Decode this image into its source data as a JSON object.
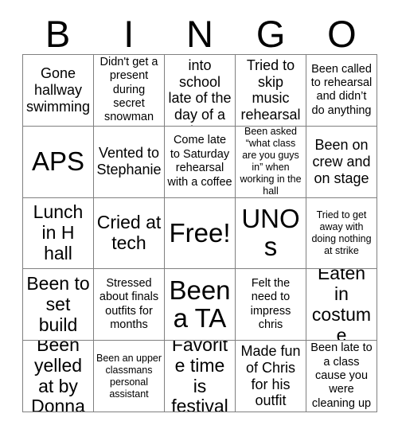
{
  "card": {
    "header_letters": [
      "B",
      "I",
      "N",
      "G",
      "O"
    ],
    "rows": [
      [
        {
          "text": "Gone hallway swimming",
          "size": "md"
        },
        {
          "text": "Didn't get a present during secret snowman",
          "size": "sm"
        },
        {
          "text": "Come into school late of the day of a show",
          "size": "md"
        },
        {
          "text": "Tried to skip music rehearsal",
          "size": "md"
        },
        {
          "text": "Been called to rehearsal and didn’t do anything",
          "size": "sm"
        }
      ],
      [
        {
          "text": "APS",
          "size": "xl"
        },
        {
          "text": "Vented to Stephanie",
          "size": "md"
        },
        {
          "text": "Come late to Saturday rehearsal with a coffee",
          "size": "sm"
        },
        {
          "text": "Been asked “what class are you guys in” when working in the hall",
          "size": "xs"
        },
        {
          "text": "Been on crew and on stage",
          "size": "md"
        }
      ],
      [
        {
          "text": "Lunch in H hall",
          "size": "lg"
        },
        {
          "text": "Cried at tech",
          "size": "lg"
        },
        {
          "text": "Free!",
          "size": "xl"
        },
        {
          "text": "UNOs",
          "size": "xl"
        },
        {
          "text": "Tried to get away with doing nothing at strike",
          "size": "xs"
        }
      ],
      [
        {
          "text": "Been to set build",
          "size": "lg"
        },
        {
          "text": "Stressed about finals outfits for months",
          "size": "sm"
        },
        {
          "text": "Been a TA",
          "size": "xl"
        },
        {
          "text": "Felt the need to impress chris",
          "size": "sm"
        },
        {
          "text": "Eaten in costume",
          "size": "lg"
        }
      ],
      [
        {
          "text": "Been yelled at by Donna",
          "size": "lg"
        },
        {
          "text": "Been an upper classmans personal assistant",
          "size": "xs"
        },
        {
          "text": "Favorite time is festival",
          "size": "lg"
        },
        {
          "text": "Made fun of Chris for his outfit",
          "size": "md"
        },
        {
          "text": "Been late to a class cause you were cleaning up",
          "size": "sm"
        }
      ]
    ]
  },
  "colors": {
    "background": "#ffffff",
    "text": "#000000",
    "grid_line": "#808080"
  }
}
